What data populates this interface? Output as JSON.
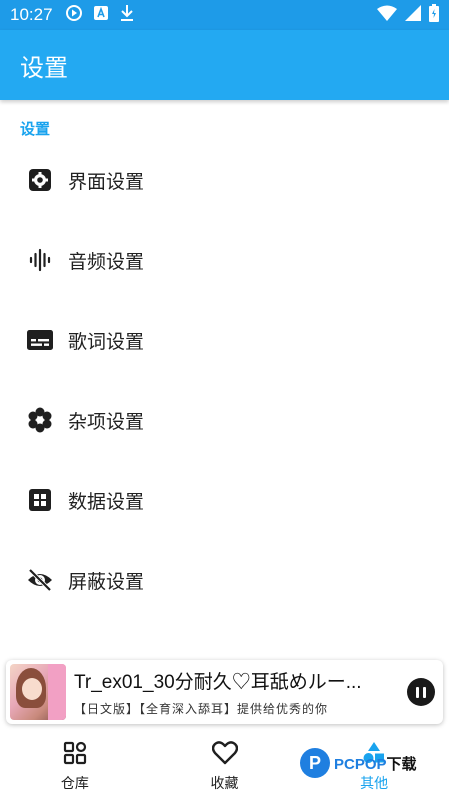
{
  "status_bar": {
    "time": "10:27",
    "icons_left": [
      "play-circle-icon",
      "text-box-icon",
      "download-icon"
    ],
    "icons_right": [
      "wifi-icon",
      "signal-icon",
      "battery-icon"
    ]
  },
  "app_bar": {
    "title": "设置"
  },
  "section": {
    "header": "设置"
  },
  "settings": {
    "items": [
      {
        "label": "界面设置",
        "icon": "gear-icon"
      },
      {
        "label": "音频设置",
        "icon": "waveform-icon"
      },
      {
        "label": "歌词设置",
        "icon": "subtitles-icon"
      },
      {
        "label": "杂项设置",
        "icon": "flower-icon"
      },
      {
        "label": "数据设置",
        "icon": "grid-icon"
      },
      {
        "label": "屏蔽设置",
        "icon": "eye-off-icon"
      }
    ]
  },
  "player": {
    "title": "Tr_ex01_30分耐久♡耳舐めルー...",
    "subtitle": "【日文版】【全育深入舔耳】提供给优秀的你",
    "state": "playing"
  },
  "bottom_nav": {
    "items": [
      {
        "label": "仓库",
        "icon": "grid-apps-icon"
      },
      {
        "label": "收藏",
        "icon": "heart-icon"
      },
      {
        "label": "其他",
        "icon": "shapes-icon"
      }
    ],
    "active_index": 2
  },
  "watermark": {
    "logo": "P",
    "text_blue": "PCPOP",
    "text_dark": "下载"
  },
  "colors": {
    "primary": "#23a9f2",
    "status_bar": "#1e9be8",
    "accent": "#19a3ee"
  }
}
